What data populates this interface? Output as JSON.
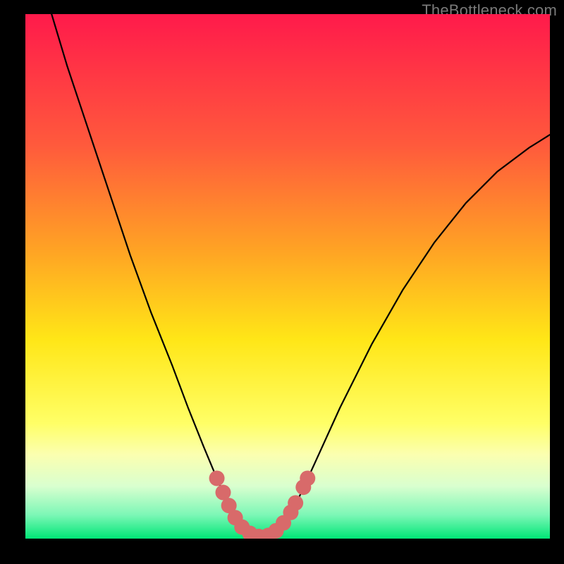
{
  "watermark": "TheBottleneck.com",
  "chart_data": {
    "type": "line",
    "title": "",
    "xlabel": "",
    "ylabel": "",
    "xlim": [
      0,
      100
    ],
    "ylim": [
      0,
      100
    ],
    "grid": false,
    "legend": false,
    "background_gradient": {
      "stops": [
        {
          "offset": 0.0,
          "color": "#ff1a4b"
        },
        {
          "offset": 0.25,
          "color": "#ff5a3c"
        },
        {
          "offset": 0.45,
          "color": "#ffa324"
        },
        {
          "offset": 0.62,
          "color": "#ffe617"
        },
        {
          "offset": 0.78,
          "color": "#ffff66"
        },
        {
          "offset": 0.84,
          "color": "#fbffb0"
        },
        {
          "offset": 0.9,
          "color": "#d9ffcf"
        },
        {
          "offset": 0.955,
          "color": "#7cf7b6"
        },
        {
          "offset": 1.0,
          "color": "#00e676"
        }
      ]
    },
    "series": [
      {
        "name": "bottleneck-curve",
        "color": "#000000",
        "stroke_width": 2.2,
        "points_xy": [
          [
            5.0,
            100.0
          ],
          [
            8.0,
            90.0
          ],
          [
            12.0,
            78.0
          ],
          [
            16.0,
            66.0
          ],
          [
            20.0,
            54.0
          ],
          [
            24.0,
            43.0
          ],
          [
            28.0,
            33.0
          ],
          [
            31.0,
            25.0
          ],
          [
            34.0,
            17.5
          ],
          [
            36.5,
            11.5
          ],
          [
            38.5,
            7.0
          ],
          [
            40.0,
            4.0
          ],
          [
            41.5,
            2.0
          ],
          [
            43.0,
            0.8
          ],
          [
            45.0,
            0.3
          ],
          [
            47.0,
            0.8
          ],
          [
            48.5,
            2.0
          ],
          [
            50.0,
            4.0
          ],
          [
            52.0,
            7.5
          ],
          [
            55.0,
            14.0
          ],
          [
            60.0,
            25.0
          ],
          [
            66.0,
            37.0
          ],
          [
            72.0,
            47.5
          ],
          [
            78.0,
            56.5
          ],
          [
            84.0,
            64.0
          ],
          [
            90.0,
            70.0
          ],
          [
            96.0,
            74.5
          ],
          [
            100.0,
            77.0
          ]
        ]
      },
      {
        "name": "highlighted-bottom-dots",
        "color": "#d86a6a",
        "marker_radius": 11,
        "points_xy": [
          [
            36.5,
            11.5
          ],
          [
            37.7,
            8.8
          ],
          [
            38.8,
            6.3
          ],
          [
            40.0,
            4.0
          ],
          [
            41.3,
            2.2
          ],
          [
            42.8,
            1.0
          ],
          [
            44.5,
            0.4
          ],
          [
            46.3,
            0.6
          ],
          [
            47.8,
            1.5
          ],
          [
            49.2,
            3.0
          ],
          [
            50.6,
            5.0
          ],
          [
            51.5,
            6.8
          ],
          [
            53.0,
            9.8
          ],
          [
            53.8,
            11.5
          ]
        ]
      }
    ]
  }
}
